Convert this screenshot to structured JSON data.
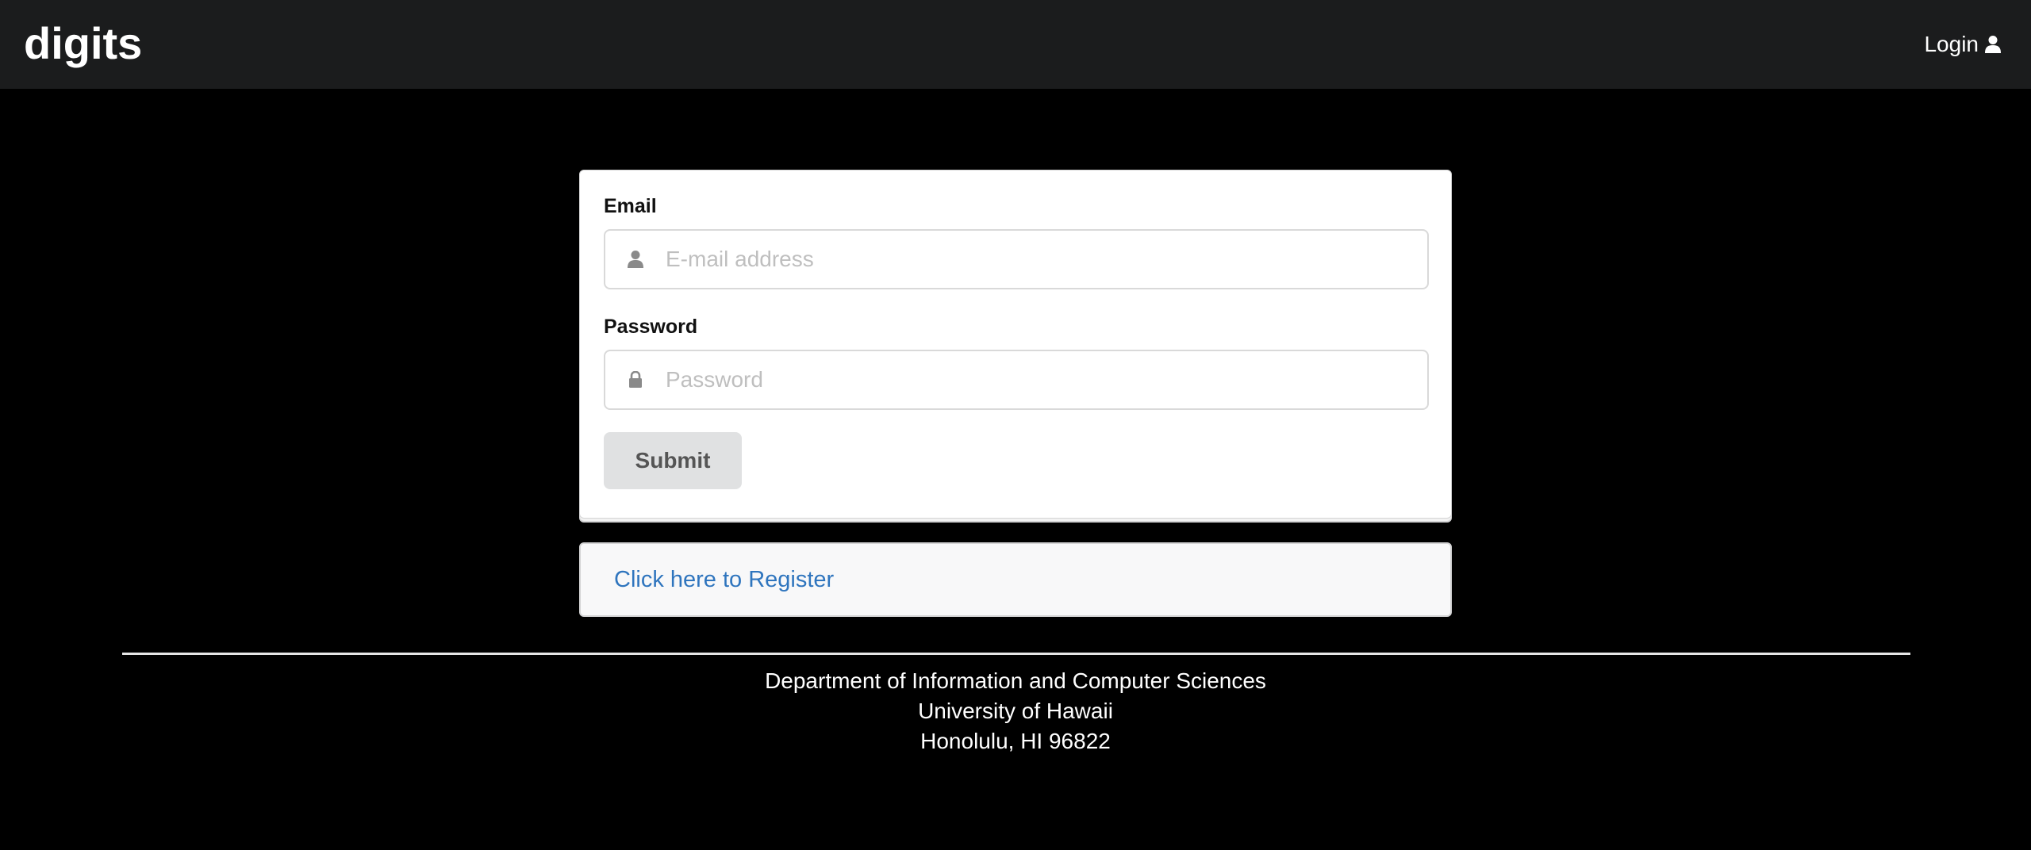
{
  "navbar": {
    "brand": "digits",
    "login_label": "Login",
    "login_icon": "user-icon"
  },
  "login_form": {
    "email_label": "Email",
    "email_placeholder": "E-mail address",
    "email_value": "",
    "email_icon": "user-icon",
    "password_label": "Password",
    "password_placeholder": "Password",
    "password_value": "",
    "password_icon": "lock-icon",
    "submit_label": "Submit"
  },
  "register": {
    "link_text": "Click here to Register"
  },
  "footer": {
    "line1": "Department of Information and Computer Sciences",
    "line2": "University of Hawaii",
    "line3": "Honolulu, HI 96822"
  },
  "colors": {
    "navbar_bg": "#1b1c1d",
    "page_bg": "#000000",
    "link": "#2f75be",
    "button_bg": "#e0e1e2"
  }
}
